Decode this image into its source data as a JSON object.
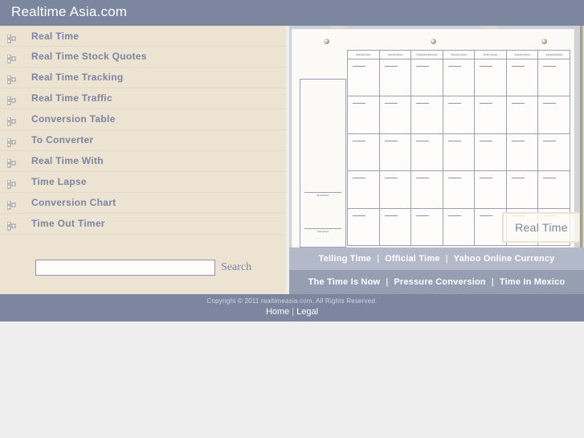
{
  "header": {
    "title": "Realtime Asia.com"
  },
  "sidebar": {
    "bullet_icon": "triple-square-bullet-icon",
    "items": [
      {
        "label": "Real Time"
      },
      {
        "label": "Real Time Stock Quotes"
      },
      {
        "label": "Real Time Tracking"
      },
      {
        "label": "Real Time Traffic"
      },
      {
        "label": "Conversion Table"
      },
      {
        "label": "To Converter"
      },
      {
        "label": "Real Time With"
      },
      {
        "label": "Time Lapse"
      },
      {
        "label": "Conversion Chart"
      },
      {
        "label": "Time Out Timer"
      }
    ]
  },
  "search": {
    "value": "",
    "placeholder": "",
    "button_label": "Search"
  },
  "calendar": {
    "overlay_label": "Real Time",
    "side_labels": [
      "Month/Mois",
      "Year/Année"
    ],
    "day_headers": [
      "Monday/Lunes",
      "Tuesday/Martes",
      "Wednesday/Miercoles",
      "Thursday/Jueves",
      "Friday/Viernes",
      "Saturday/Sabado",
      "Sunday/Domingo"
    ],
    "week_rows": 5
  },
  "linkbars": [
    {
      "links": [
        "Telling Time",
        "Official Time",
        "Yahoo Online Currency"
      ],
      "separator": "|"
    },
    {
      "links": [
        "The Time Is Now",
        "Pressure Conversion",
        "Time In Mexico"
      ],
      "separator": "|"
    }
  ],
  "footer": {
    "copyright": "Copyright © 2011 realtimeasia.com. All Rights Reserved.",
    "links": [
      "Home",
      "Legal"
    ],
    "separator": "|"
  },
  "colors": {
    "header_bg": "#7c869f",
    "sidebar_bg": "#ece3d2",
    "link_text": "#7b84a0",
    "linkbar_light": "#b3b9c9",
    "linkbar_dark": "#969eb2",
    "footer_bg": "#7c869f",
    "page_bg": "#eeeeee"
  }
}
